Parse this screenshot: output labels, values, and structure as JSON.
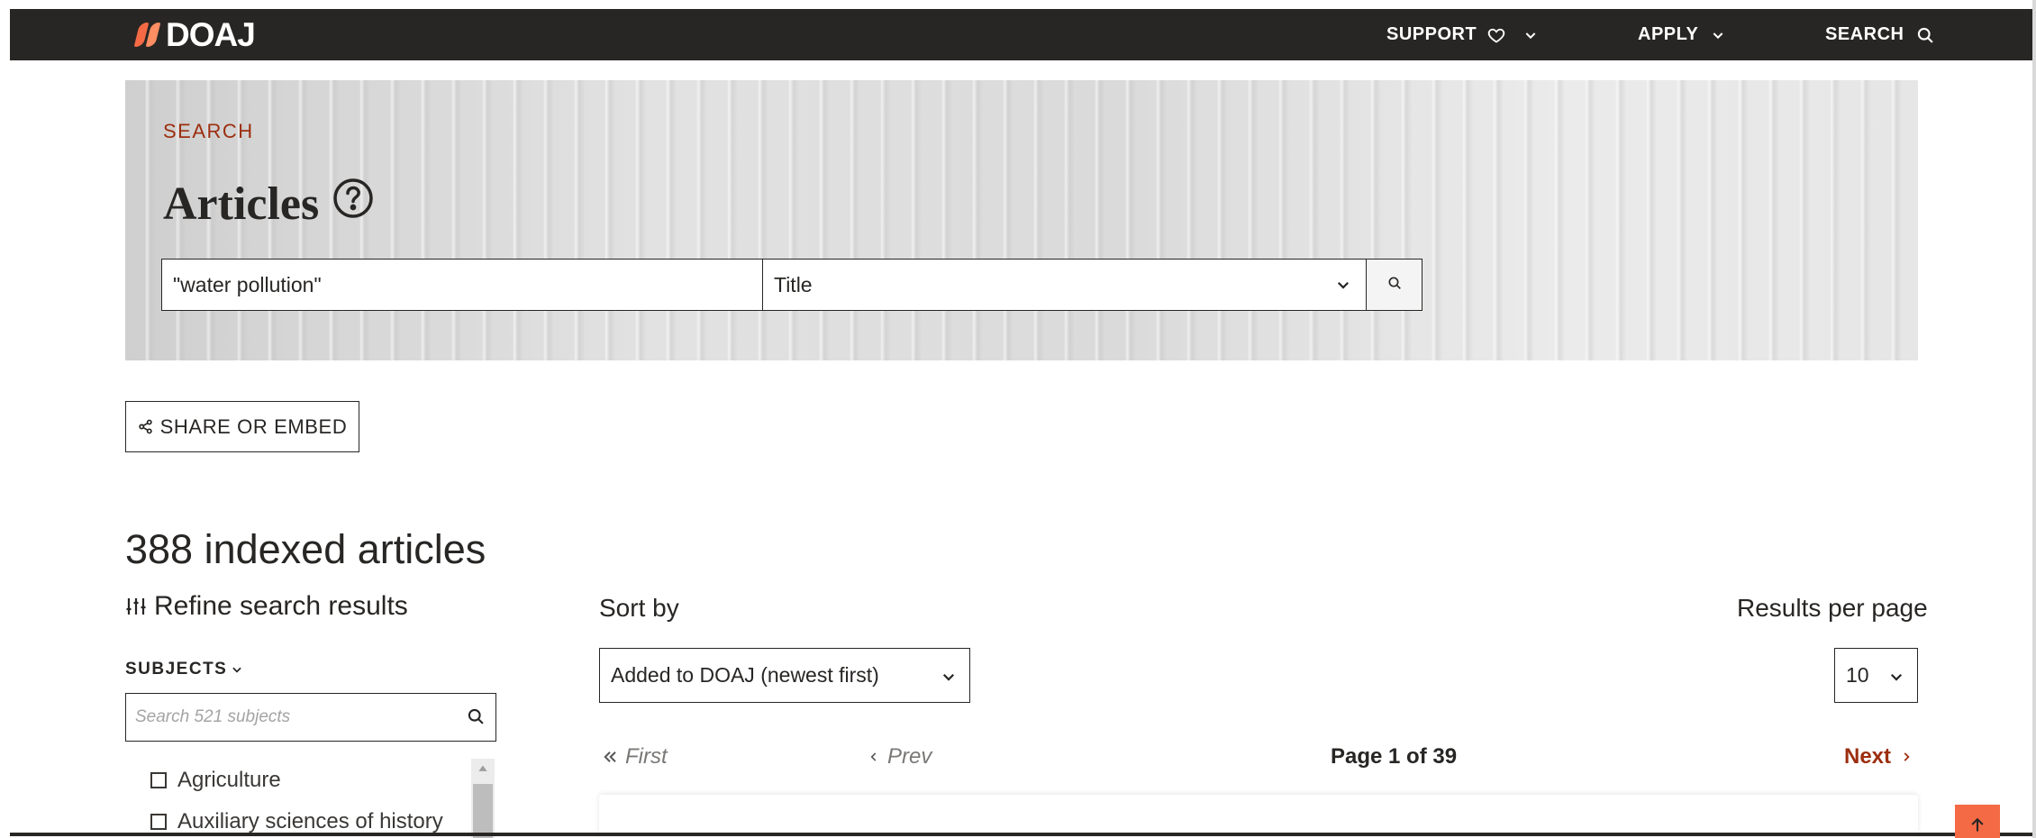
{
  "header": {
    "logo_text": "DOAJ",
    "nav": {
      "support": "SUPPORT",
      "apply": "APPLY",
      "search": "SEARCH"
    }
  },
  "hero": {
    "eyebrow": "SEARCH",
    "title": "Articles",
    "search_value": "\"water pollution\"",
    "field_selected": "Title"
  },
  "share_label": "SHARE OR EMBED",
  "results": {
    "count_text": "388 indexed articles"
  },
  "refine": {
    "label": "Refine search results",
    "subjects_label": "SUBJECTS",
    "subjects_placeholder": "Search 521 subjects",
    "items": [
      {
        "label": "Agriculture",
        "checked": false
      },
      {
        "label": "Auxiliary sciences of history",
        "checked": false
      }
    ]
  },
  "sort": {
    "label": "Sort by",
    "selected": "Added to DOAJ (newest first)",
    "per_page_label": "Results per page",
    "per_page_selected": "10"
  },
  "pager": {
    "first": "First",
    "prev": "Prev",
    "info": "Page 1 of 39",
    "next": "Next"
  },
  "colors": {
    "dark": "#282624",
    "accent": "#9c2e0f",
    "brand_orange": "#f46a45"
  },
  "icons": [
    "heart-icon",
    "chevron-down-icon",
    "search-icon",
    "help-circle-icon",
    "share-icon",
    "sliders-icon",
    "chevrons-left-icon",
    "chevron-left-icon",
    "chevron-right-icon",
    "arrow-up-icon"
  ]
}
